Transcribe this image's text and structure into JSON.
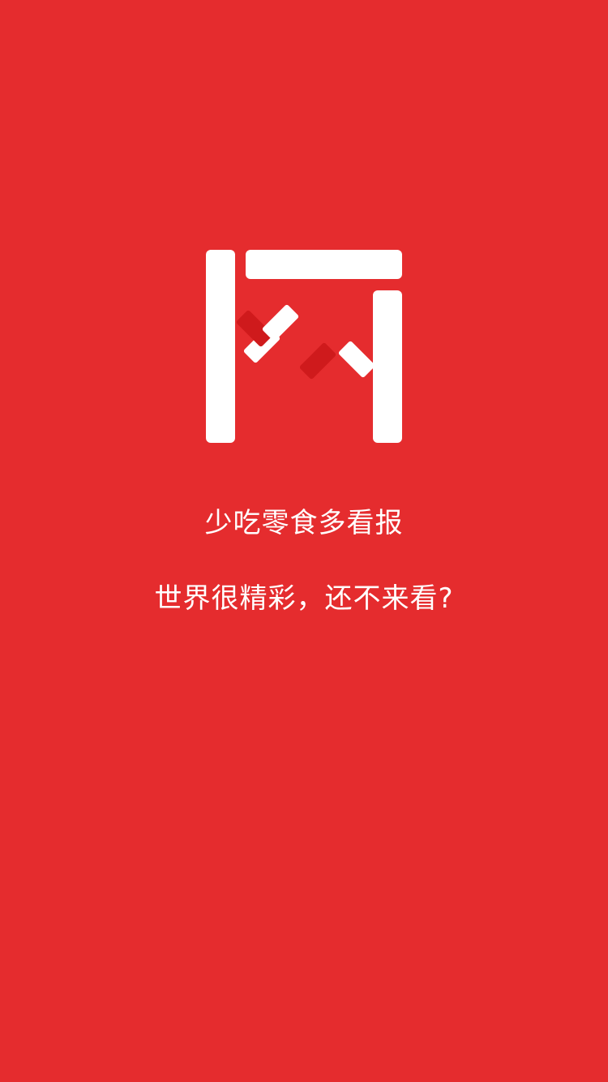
{
  "splash": {
    "logo_name": "app-logo",
    "tagline_line1": "少吃零食多看报",
    "tagline_line2": "世界很精彩，还不来看?",
    "background_color": "#e52c2e",
    "accent_dark_color": "#cf1a1c"
  }
}
